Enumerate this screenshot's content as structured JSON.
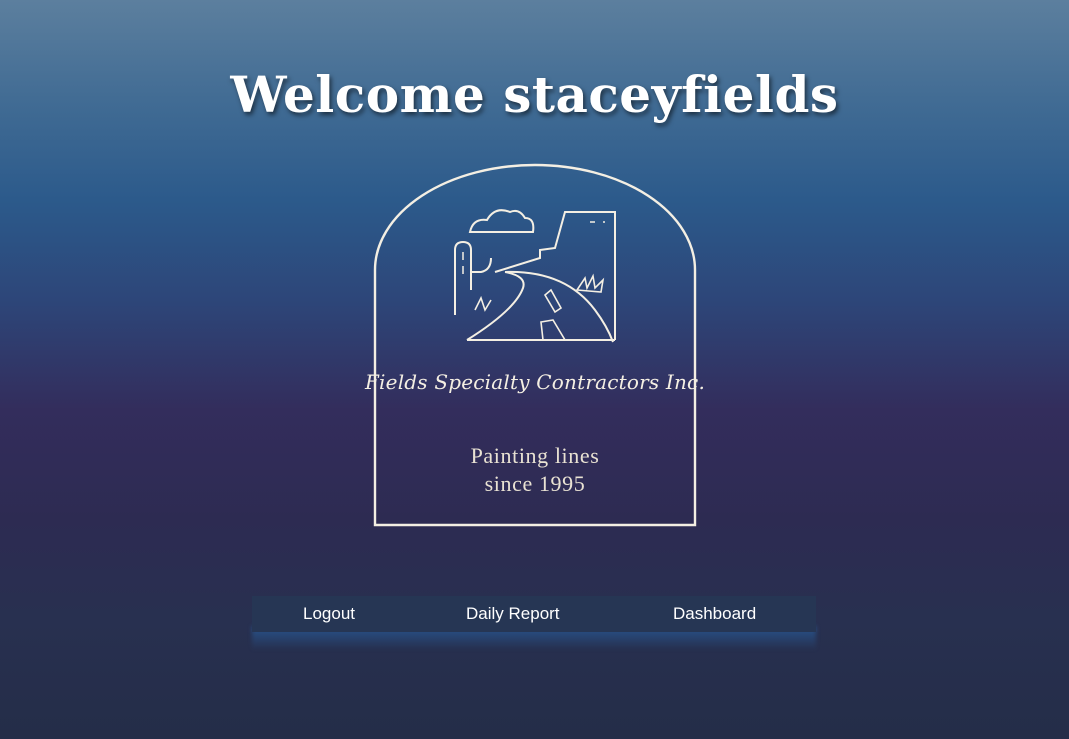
{
  "header": {
    "title": "Welcome staceyfields"
  },
  "logo": {
    "company_name": "Fields Specialty Contractors Inc.",
    "tagline_line1": "Painting lines",
    "tagline_line2": "since 1995",
    "line_color": "#f4efe3"
  },
  "nav": {
    "items": [
      {
        "label": "Logout"
      },
      {
        "label": "Daily Report"
      },
      {
        "label": "Dashboard"
      }
    ]
  }
}
